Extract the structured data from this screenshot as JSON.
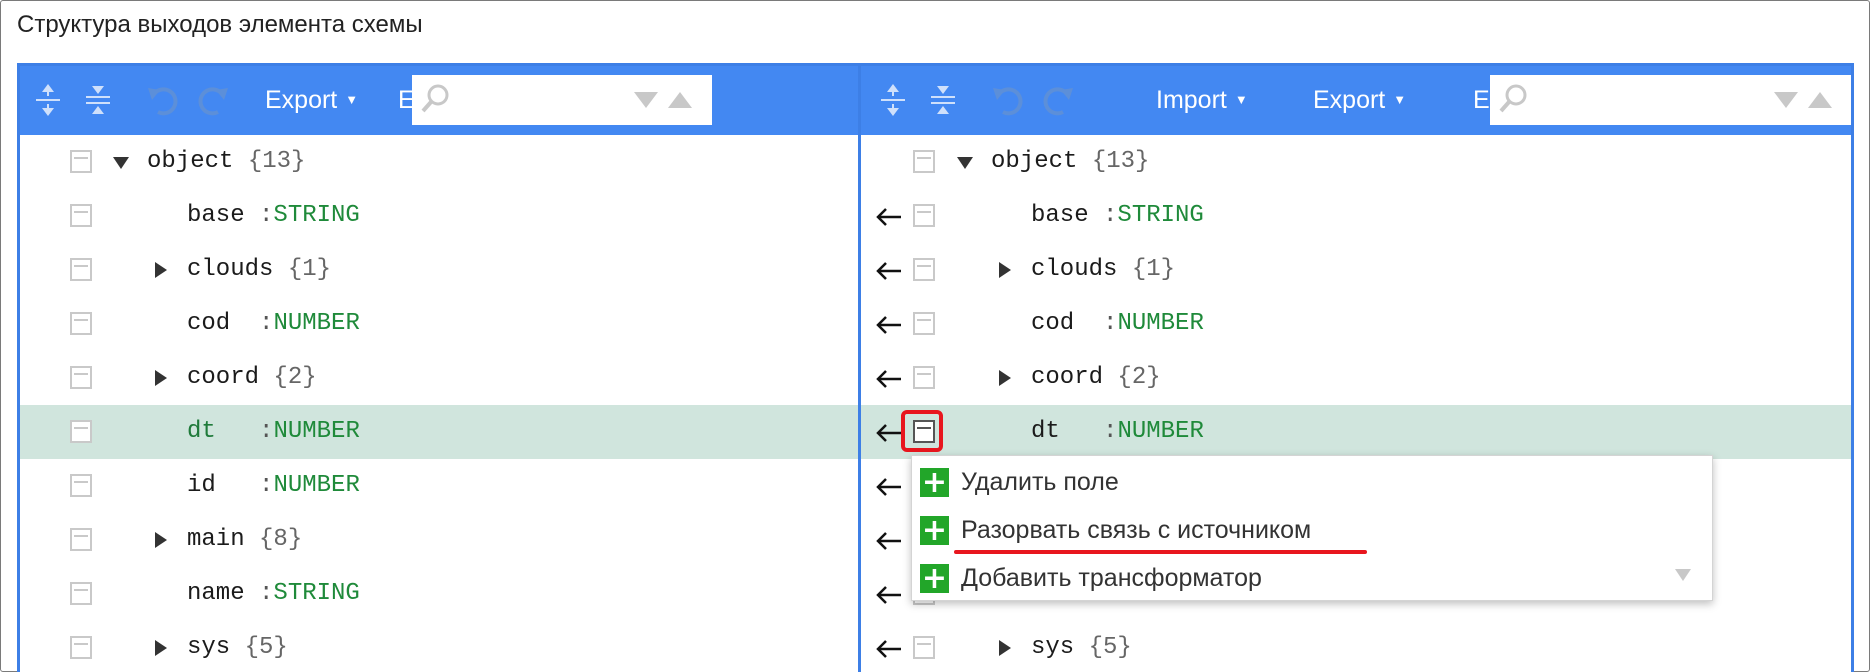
{
  "window": {
    "title": "Структура выходов элемента схемы"
  },
  "left_panel": {
    "toolbar": {
      "export_label": "Export",
      "cut_label": "E",
      "search_placeholder": ""
    },
    "rows": [
      {
        "indent": 0,
        "expander": "down",
        "name": "object",
        "sep": "",
        "type": "",
        "count": "{13}"
      },
      {
        "indent": 1,
        "expander": "",
        "name": "base",
        "sep": ":",
        "type": "STRING",
        "count": ""
      },
      {
        "indent": 1,
        "expander": "right",
        "name": "clouds",
        "sep": "",
        "type": "",
        "count": "{1}"
      },
      {
        "indent": 1,
        "expander": "",
        "name": "cod",
        "sep": ":",
        "type": "NUMBER",
        "count": ""
      },
      {
        "indent": 1,
        "expander": "right",
        "name": "coord",
        "sep": "",
        "type": "",
        "count": "{2}"
      },
      {
        "indent": 1,
        "expander": "",
        "name": "dt",
        "sep": ":",
        "type": "NUMBER",
        "count": "",
        "selected": true
      },
      {
        "indent": 1,
        "expander": "",
        "name": "id",
        "sep": ":",
        "type": "NUMBER",
        "count": ""
      },
      {
        "indent": 1,
        "expander": "right",
        "name": "main",
        "sep": "",
        "type": "",
        "count": "{8}"
      },
      {
        "indent": 1,
        "expander": "",
        "name": "name",
        "sep": ":",
        "type": "STRING",
        "count": ""
      },
      {
        "indent": 1,
        "expander": "right",
        "name": "sys",
        "sep": "",
        "type": "",
        "count": "{5}"
      }
    ]
  },
  "right_panel": {
    "toolbar": {
      "import_label": "Import",
      "export_label": "Export",
      "cut_label": "E",
      "search_placeholder": ""
    },
    "rows": [
      {
        "indent": 0,
        "expander": "down",
        "name": "object",
        "sep": "",
        "type": "",
        "count": "{13}",
        "linked": false
      },
      {
        "indent": 1,
        "expander": "",
        "name": "base",
        "sep": ":",
        "type": "STRING",
        "count": "",
        "linked": true
      },
      {
        "indent": 1,
        "expander": "right",
        "name": "clouds",
        "sep": "",
        "type": "",
        "count": "{1}",
        "linked": true
      },
      {
        "indent": 1,
        "expander": "",
        "name": "cod",
        "sep": ":",
        "type": "NUMBER",
        "count": "",
        "linked": true
      },
      {
        "indent": 1,
        "expander": "right",
        "name": "coord",
        "sep": "",
        "type": "",
        "count": "{2}",
        "linked": true
      },
      {
        "indent": 1,
        "expander": "",
        "name": "dt",
        "sep": ":",
        "type": "NUMBER",
        "count": "",
        "linked": true,
        "selected": true
      },
      {
        "indent": 1,
        "expander": "",
        "name": "",
        "sep": "",
        "type": "",
        "count": "",
        "linked": true,
        "hidden": true
      },
      {
        "indent": 1,
        "expander": "",
        "name": "",
        "sep": "",
        "type": "",
        "count": "",
        "linked": true,
        "hidden": true
      },
      {
        "indent": 1,
        "expander": "",
        "name": "",
        "sep": "",
        "type": "",
        "count": "",
        "linked": true,
        "hidden": true
      },
      {
        "indent": 1,
        "expander": "right",
        "name": "sys",
        "sep": "",
        "type": "",
        "count": "{5}",
        "linked": true
      }
    ]
  },
  "context_menu": {
    "items": [
      {
        "label": "Удалить поле"
      },
      {
        "label": "Разорвать связь с источником"
      },
      {
        "label": "Добавить трансформатор"
      }
    ]
  },
  "colors": {
    "toolbar_bg": "#4388f2",
    "panel_border": "#3d7fe6",
    "selected_row": "#d0e5dd",
    "type_green": "#1f8a3a",
    "plus_green": "#22a629",
    "highlight_red": "#e8161e"
  },
  "icons": {
    "toolbar": [
      "expand-all-icon",
      "collapse-all-icon",
      "undo-icon",
      "redo-icon",
      "search-icon",
      "search-prev-icon",
      "search-next-icon"
    ],
    "rows": [
      "checkbox-icon",
      "expander-triangle-icon",
      "link-arrow-icon"
    ],
    "menu": [
      "plus-icon",
      "scroll-down-icon"
    ]
  }
}
